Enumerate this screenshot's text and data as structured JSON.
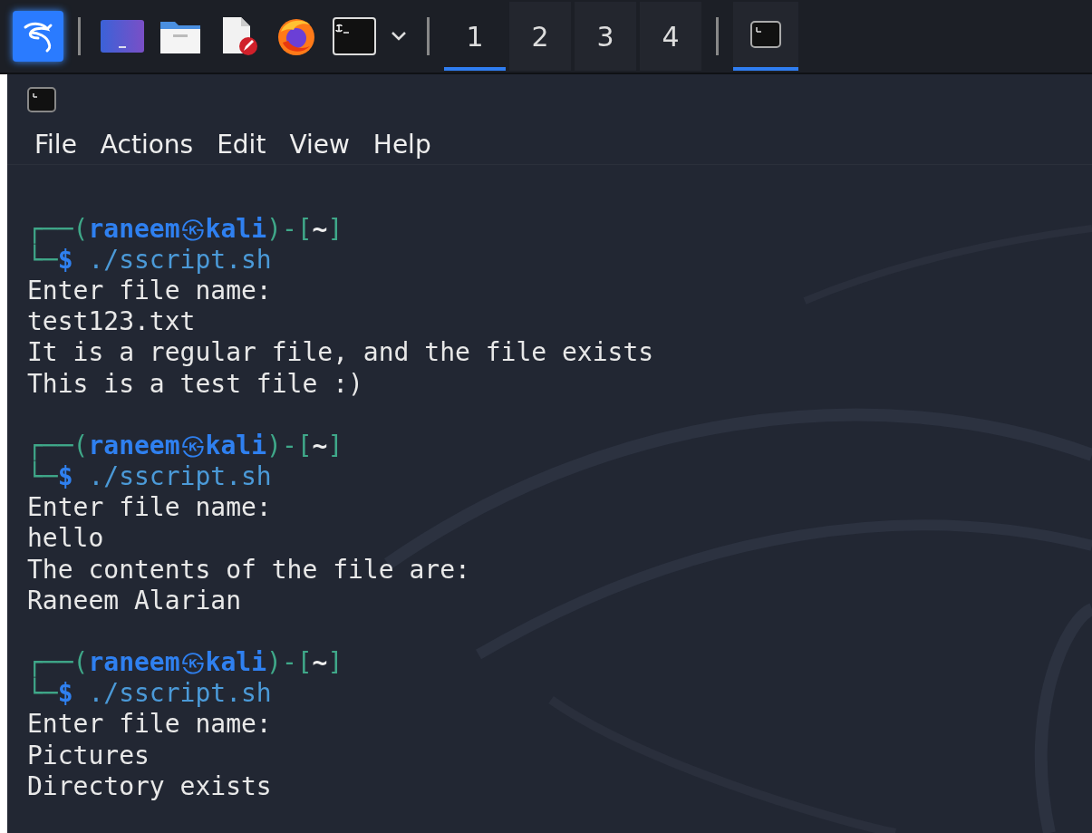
{
  "taskbar": {
    "workspaces": [
      {
        "label": "1",
        "selected": true
      },
      {
        "label": "2",
        "selected": false
      },
      {
        "label": "3",
        "selected": false
      },
      {
        "label": "4",
        "selected": false
      }
    ],
    "tasks": [
      {
        "selected": true
      }
    ]
  },
  "terminal": {
    "menu": [
      "File",
      "Actions",
      "Edit",
      "View",
      "Help"
    ],
    "sessions": [
      {
        "prompt": {
          "open": "┌──(",
          "user": "raneem",
          "at": "㉿",
          "host": "kali",
          "mid": ")-[",
          "dir": "~",
          "close": "]",
          "corner": "└─",
          "sign": "$",
          "command": "./sscript.sh"
        },
        "output": [
          "Enter file name:",
          "test123.txt",
          "It is a regular file, and the file exists",
          "This is a test file :)"
        ]
      },
      {
        "prompt": {
          "open": "┌──(",
          "user": "raneem",
          "at": "㉿",
          "host": "kali",
          "mid": ")-[",
          "dir": "~",
          "close": "]",
          "corner": "└─",
          "sign": "$",
          "command": "./sscript.sh"
        },
        "output": [
          "Enter file name:",
          "hello",
          "The contents of the file are:",
          "Raneem Alarian"
        ]
      },
      {
        "prompt": {
          "open": "┌──(",
          "user": "raneem",
          "at": "㉿",
          "host": "kali",
          "mid": ")-[",
          "dir": "~",
          "close": "]",
          "corner": "└─",
          "sign": "$",
          "command": "./sscript.sh"
        },
        "output": [
          "Enter file name:",
          "Pictures",
          "Directory exists"
        ]
      }
    ]
  }
}
